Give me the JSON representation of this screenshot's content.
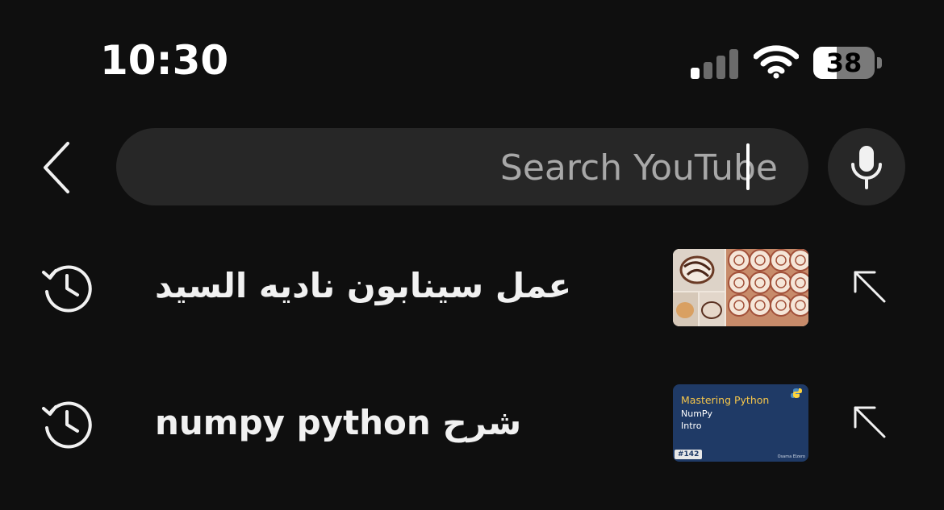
{
  "status_bar": {
    "time": "10:30",
    "battery_percent": "38",
    "battery_level": 0.38,
    "signal_bars_active": 1,
    "signal_bars_total": 4,
    "wifi": "connected"
  },
  "search": {
    "placeholder": "Search YouTube",
    "value": ""
  },
  "icons": {
    "back": "chevron-left-icon",
    "mic": "mic-icon",
    "history": "history-icon",
    "fill": "arrow-up-left-icon"
  },
  "suggestions": [
    {
      "text": "عمل سينابون ناديه السيد",
      "thumbnail": "cinnamon-rolls-thumbnail"
    },
    {
      "text": "numpy python شرح",
      "thumbnail": "python-numpy-thumbnail",
      "thumb_title": "Mastering Python",
      "thumb_line1": "NumPy",
      "thumb_line2": "Intro",
      "thumb_badge": "#142",
      "thumb_credit": "Osama Elzero"
    }
  ],
  "colors": {
    "background": "#0f0f0f",
    "search_bg": "#272727",
    "text": "#f1f1f1",
    "placeholder": "#a8a8a8"
  }
}
